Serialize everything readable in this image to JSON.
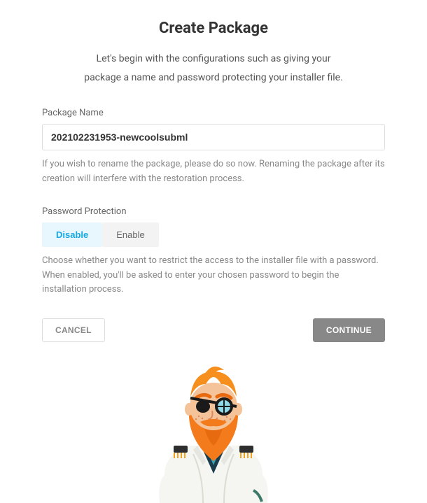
{
  "title": "Create Package",
  "subtitle_line1": "Let's begin with the configurations such as giving your",
  "subtitle_line2": "package a name and password protecting your installer file.",
  "packageName": {
    "label": "Package Name",
    "value": "202102231953-newcoolsubml",
    "help": "If you wish to rename the package, please do so now. Renaming the package after its creation will interfere with the restoration process."
  },
  "passwordProtection": {
    "label": "Password Protection",
    "options": {
      "disable": "Disable",
      "enable": "Enable"
    },
    "active": "disable",
    "help": "Choose whether you want to restrict the access to the installer file with a password. When enabled, you'll be asked to enter your chosen password to begin the installation process."
  },
  "actions": {
    "cancel": "CANCEL",
    "continue": "CONTINUE"
  }
}
